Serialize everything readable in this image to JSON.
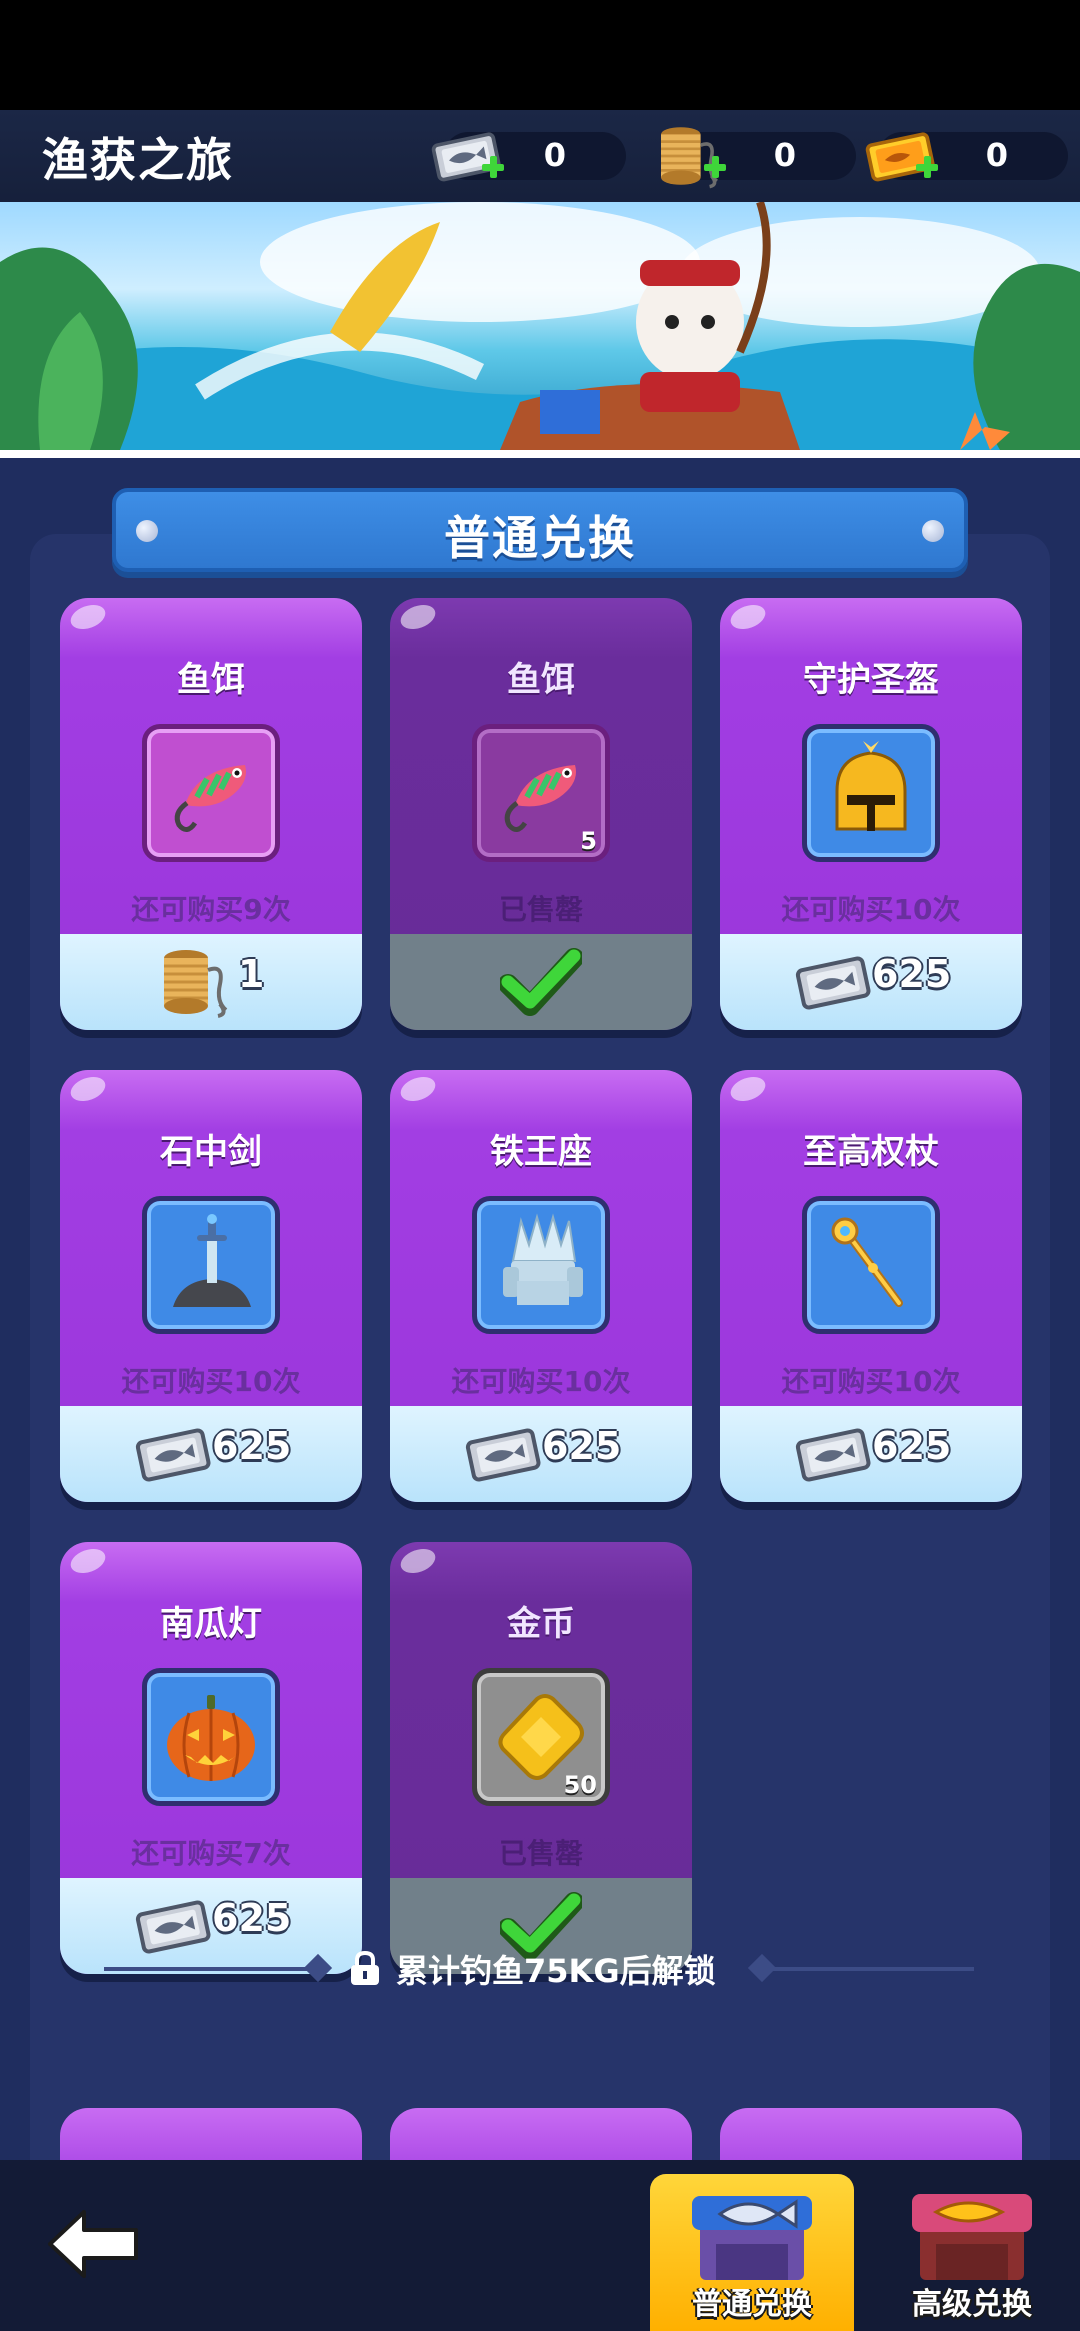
{
  "header": {
    "title": "渔获之旅",
    "currencies": [
      {
        "icon": "fish-ticket-icon",
        "count": "0"
      },
      {
        "icon": "fishing-line-spool-icon",
        "count": "0"
      },
      {
        "icon": "gold-ticket-icon",
        "count": "0"
      }
    ]
  },
  "section": {
    "title": "普通兑换"
  },
  "cards": [
    {
      "name": "鱼饵",
      "item_icon": "fishing-lure-icon",
      "limit": "还可购买9次",
      "price": "1",
      "currency": "fishing-line-spool-icon",
      "sold": false
    },
    {
      "name": "鱼饵",
      "item_icon": "fishing-lure-icon",
      "qty": "5",
      "limit": "已售罄",
      "sold": true
    },
    {
      "name": "守护圣盔",
      "item_icon": "golden-helmet-icon",
      "limit": "还可购买10次",
      "price": "625",
      "currency": "fish-ticket-icon",
      "sold": false
    },
    {
      "name": "石中剑",
      "item_icon": "sword-in-stone-icon",
      "limit": "还可购买10次",
      "price": "625",
      "currency": "fish-ticket-icon",
      "sold": false
    },
    {
      "name": "铁王座",
      "item_icon": "iron-throne-icon",
      "limit": "还可购买10次",
      "price": "625",
      "currency": "fish-ticket-icon",
      "sold": false
    },
    {
      "name": "至高权杖",
      "item_icon": "scepter-icon",
      "limit": "还可购买10次",
      "price": "625",
      "currency": "fish-ticket-icon",
      "sold": false
    },
    {
      "name": "南瓜灯",
      "item_icon": "jack-o-lantern-icon",
      "limit": "还可购买7次",
      "price": "625",
      "currency": "fish-ticket-icon",
      "sold": false
    },
    {
      "name": "金币",
      "item_icon": "gold-coin-icon",
      "qty": "50",
      "limit": "已售罄",
      "sold": true
    }
  ],
  "unlock": {
    "text": "累计钓鱼75KG后解锁"
  },
  "nav": {
    "back": "back-arrow-icon",
    "tabs": [
      {
        "label": "普通兑换",
        "active": true
      },
      {
        "label": "高级兑换",
        "active": false
      }
    ]
  },
  "colors": {
    "accent_gold": "#ffc21a",
    "panel": "#26346a",
    "card_purple": "#9a35da",
    "check_green": "#3fd63a"
  }
}
